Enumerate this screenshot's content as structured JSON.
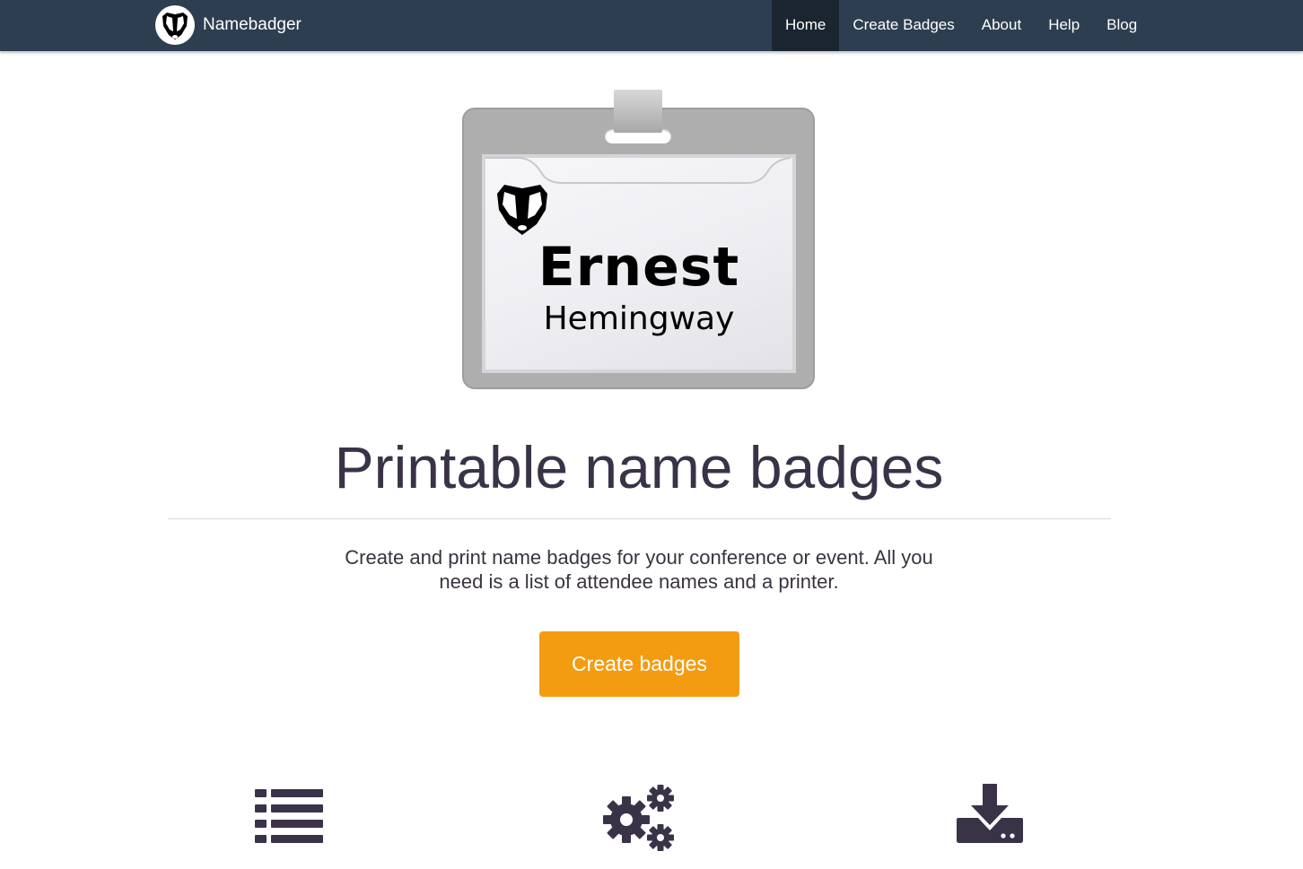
{
  "navbar": {
    "brand_name": "Namebadger",
    "brand_logo_icon": "badger-logo-icon",
    "background": "#2c3e50",
    "items": [
      {
        "label": "Home",
        "active": true
      },
      {
        "label": "Create Badges",
        "active": false
      },
      {
        "label": "About",
        "active": false
      },
      {
        "label": "Help",
        "active": false
      },
      {
        "label": "Blog",
        "active": false
      }
    ]
  },
  "badge_preview": {
    "first_name": "Ernest",
    "last_name": "Hemingway",
    "logo_icon": "badger-logo-icon"
  },
  "hero": {
    "title": "Printable name badges",
    "lead": "Create and print name badges for your conference or event. All you need is a list of attendee names and a printer.",
    "cta_label": "Create badges",
    "cta_color": "#f39c12"
  },
  "features": [
    {
      "icon": "list-icon"
    },
    {
      "icon": "gears-icon"
    },
    {
      "icon": "download-icon"
    }
  ]
}
